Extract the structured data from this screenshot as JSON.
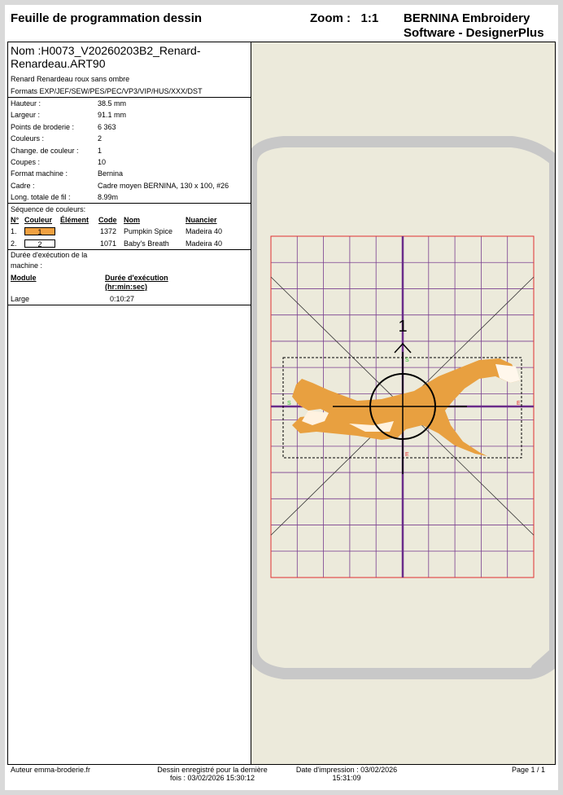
{
  "header": {
    "title": "Feuille de programmation dessin",
    "zoom_label": "Zoom :",
    "zoom_value": "1:1",
    "brand_line1": "BERNINA Embroidery",
    "brand_line2": "Software - DesignerPlus"
  },
  "design": {
    "name_line1": "Nom :H0073_V20260203B2_Renard-",
    "name_line2": "Renardeau.ART90",
    "description": "Renard Renardeau roux sans ombre",
    "formats": "Formats EXP/JEF/SEW/PES/PEC/VP3/VIP/HUS/XXX/DST"
  },
  "properties": [
    {
      "label": "Hauteur :",
      "value": "38.5 mm"
    },
    {
      "label": "Largeur :",
      "value": "91.1 mm"
    },
    {
      "label": "Points de broderie :",
      "value": "6 363"
    },
    {
      "label": "Couleurs :",
      "value": "2"
    },
    {
      "label": "Change. de couleur :",
      "value": "1"
    },
    {
      "label": "Coupes :",
      "value": "10"
    },
    {
      "label": "Format machine :",
      "value": "Bernina"
    },
    {
      "label": "Cadre :",
      "value": "Cadre moyen BERNINA, 130 x 100, #26"
    },
    {
      "label": "Long. totale de fil :",
      "value": "8.99m"
    }
  ],
  "color_sequence": {
    "title": "Séquence de couleurs:",
    "headers": {
      "no": "N°",
      "color": "Couleur",
      "element": "Élément",
      "code": "Code",
      "name": "Nom",
      "chart": "Nuancier"
    },
    "rows": [
      {
        "no": "1.",
        "swatch": "1",
        "swatch_color": "#f0a040",
        "code": "1372",
        "name": "Pumpkin Spice",
        "chart": "Madeira 40"
      },
      {
        "no": "2.",
        "swatch": "2",
        "swatch_color": "#ffffff",
        "code": "1071",
        "name": "Baby's Breath",
        "chart": "Madeira 40"
      }
    ]
  },
  "runtime": {
    "title_line1": "Durée d'exécution de la",
    "title_line2": "machine :",
    "col_module": "Module",
    "col_time_line1": "Durée d'exécution",
    "col_time_line2": "(hr:min:sec)",
    "module": "Large",
    "time": "0:10:27"
  },
  "preview": {
    "center_label": "1",
    "marker_s": "S",
    "marker_e": "E"
  },
  "footer": {
    "author": "Auteur emma-broderie.fr",
    "saved_line1": "Dessin enregistré pour la dernière",
    "saved_line2": "fois : 03/02/2026 15:30:12",
    "printed_line1": "Date d'impression : 03/02/2026",
    "printed_line2": "15:31:09",
    "page": "Page 1 / 1"
  },
  "colors": {
    "hoop": "#c9c9c9",
    "field": "#eceadb",
    "grid": "#7a3f8f",
    "border": "#e03030",
    "fox": "#e8a040"
  }
}
